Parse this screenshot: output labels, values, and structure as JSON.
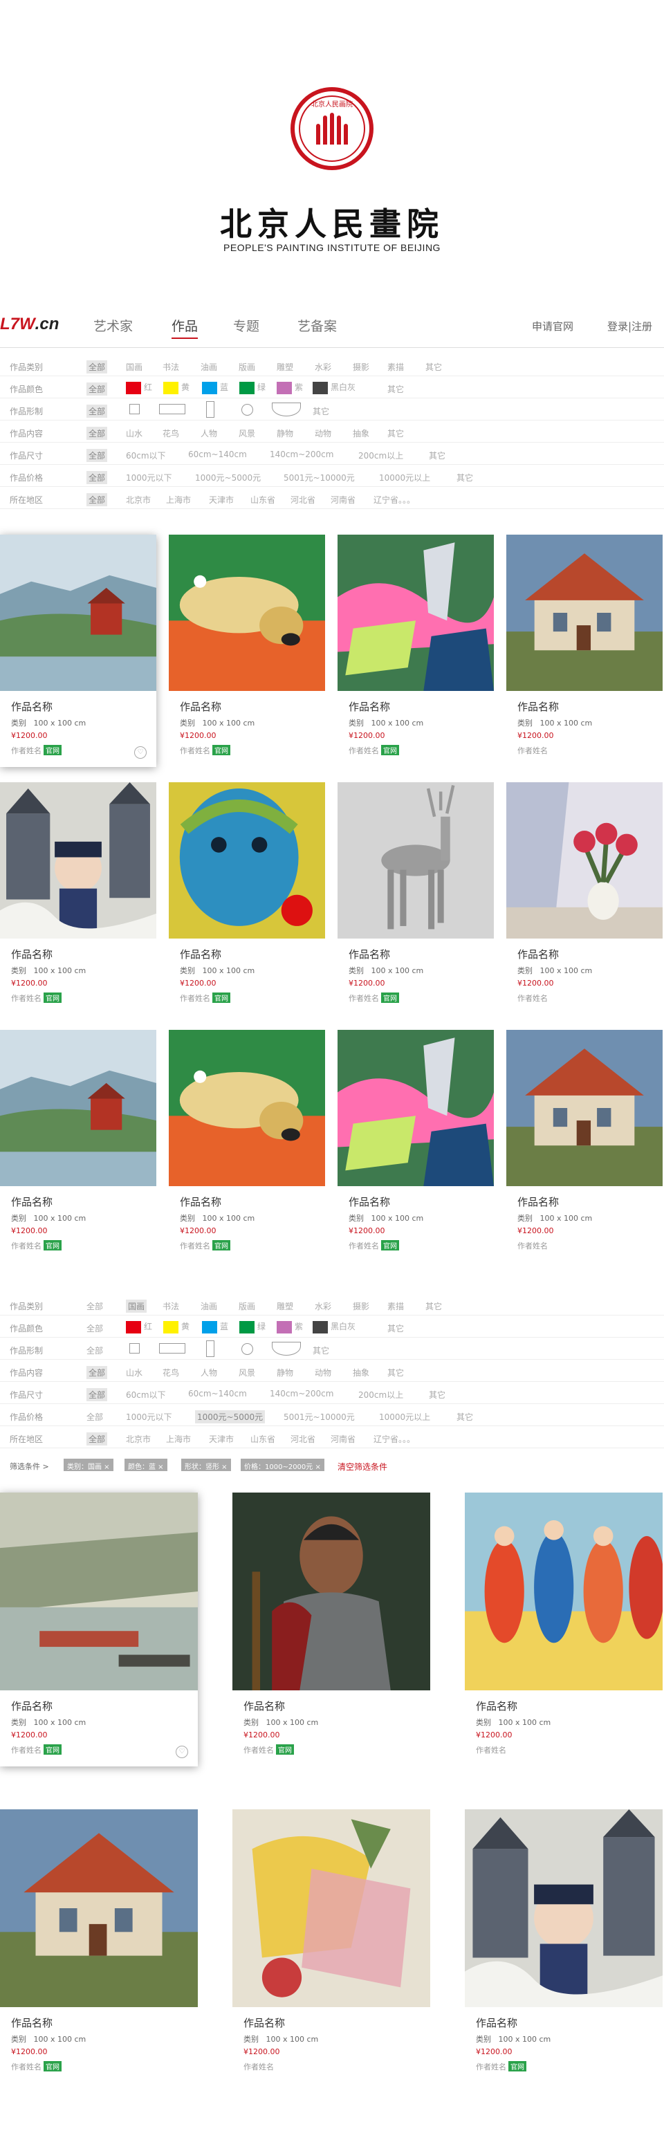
{
  "brand": {
    "seal_text": "北京人民画院",
    "name_cn": "北京人民畫院",
    "name_en": "PEOPLE'S PAINTING INSTITUTE OF BEIJING"
  },
  "nav": {
    "logo_red": "L7W",
    "logo_dark": ".cn",
    "tabs": [
      "艺术家",
      "作品",
      "专题",
      "艺备案"
    ],
    "active_tab": "作品",
    "apply": "申请官网",
    "login": "登录|注册"
  },
  "filter": {
    "type": {
      "label": "作品类别",
      "options": [
        "全部",
        "国画",
        "书法",
        "油画",
        "版画",
        "雕塑",
        "水彩",
        "摄影",
        "素描",
        "其它"
      ]
    },
    "color": {
      "label": "作品颜色",
      "all": "全部",
      "swatches": [
        {
          "name": "红",
          "hex": "#e60012"
        },
        {
          "name": "黄",
          "hex": "#fff100"
        },
        {
          "name": "蓝",
          "hex": "#00a0e9"
        },
        {
          "name": "绿",
          "hex": "#009944"
        },
        {
          "name": "紫",
          "hex": "#c36fb5"
        },
        {
          "name": "黑白灰",
          "hex": "#444444"
        }
      ],
      "other": "其它"
    },
    "shape": {
      "label": "作品形制",
      "all": "全部",
      "other": "其它"
    },
    "content": {
      "label": "作品内容",
      "options": [
        "全部",
        "山水",
        "花鸟",
        "人物",
        "风景",
        "静物",
        "动物",
        "抽象",
        "其它"
      ]
    },
    "size": {
      "label": "作品尺寸",
      "options": [
        "全部",
        "60cm以下",
        "60cm~140cm",
        "140cm~200cm",
        "200cm以上",
        "其它"
      ]
    },
    "price": {
      "label": "作品价格",
      "options": [
        "全部",
        "1000元以下",
        "1000元~5000元",
        "5001元~10000元",
        "10000元以上",
        "其它"
      ]
    },
    "region": {
      "label": "所在地区",
      "options": [
        "全部",
        "北京市",
        "上海市",
        "天津市",
        "山东省",
        "河北省",
        "河南省",
        "辽宁省。。。"
      ]
    }
  },
  "conditions": {
    "label": "筛选条件 >",
    "chips": [
      "类别：国画 ×",
      "颜色：蓝 ×",
      "形状：竖形 ×",
      "价格：1000~2000元 ×"
    ],
    "clear": "清空筛选条件"
  },
  "card_text": {
    "title": "作品名称",
    "category": "类别",
    "size": "100 x 100 cm",
    "price": "¥1200.00",
    "author": "作者姓名",
    "badge": "官网"
  },
  "grid1": [
    {
      "art": "landscape",
      "badge": true,
      "fav": true
    },
    {
      "art": "dog",
      "badge": true,
      "fav": false
    },
    {
      "art": "abstract",
      "badge": true,
      "fav": false
    },
    {
      "art": "house",
      "badge": false,
      "fav": false
    },
    {
      "art": "castle",
      "badge": true,
      "fav": false
    },
    {
      "art": "blueface",
      "badge": true,
      "fav": false
    },
    {
      "art": "deer",
      "badge": true,
      "fav": false
    },
    {
      "art": "flower",
      "badge": false,
      "fav": false
    },
    {
      "art": "landscape",
      "badge": true,
      "fav": false
    },
    {
      "art": "dog",
      "badge": true,
      "fav": false
    },
    {
      "art": "abstract",
      "badge": true,
      "fav": false
    },
    {
      "art": "house",
      "badge": false,
      "fav": false
    }
  ],
  "grid2": [
    {
      "art": "harbor",
      "badge": true,
      "fav": true
    },
    {
      "art": "warrior",
      "badge": true,
      "fav": false
    },
    {
      "art": "dancers",
      "badge": false,
      "fav": false
    },
    {
      "art": "house",
      "badge": true,
      "fav": false
    },
    {
      "art": "abstract2",
      "badge": false,
      "fav": false
    },
    {
      "art": "castle",
      "badge": true,
      "fav": false
    }
  ]
}
